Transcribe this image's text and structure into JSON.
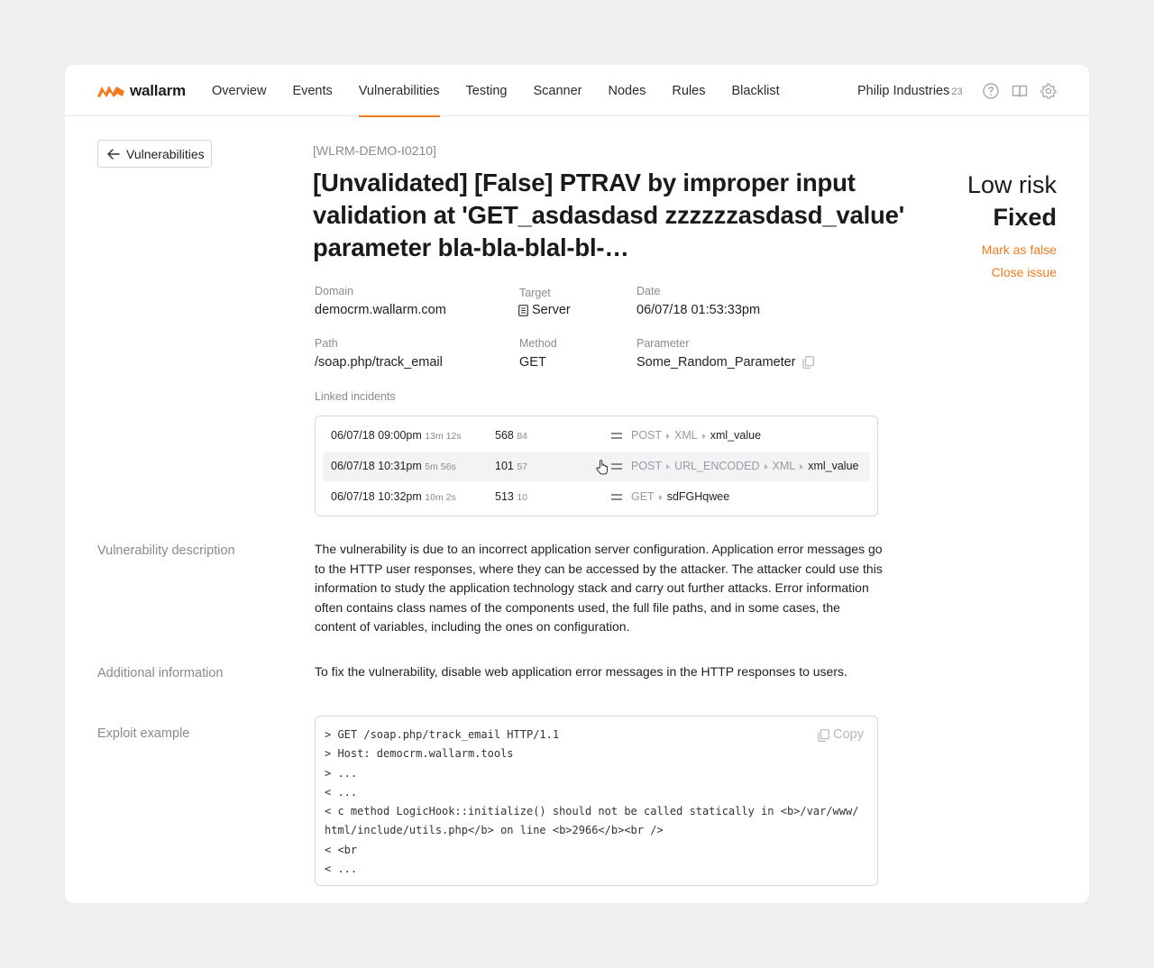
{
  "brand": {
    "name": "wallarm",
    "accent": "#f07b20"
  },
  "nav": {
    "items": [
      "Overview",
      "Events",
      "Vulnerabilities",
      "Testing",
      "Scanner",
      "Nodes",
      "Rules",
      "Blacklist"
    ],
    "active": "Vulnerabilities"
  },
  "account": {
    "name": "Philip Industries",
    "count": "23"
  },
  "header_icons": [
    "help-icon",
    "book-icon",
    "gear-icon"
  ],
  "back_button": "Vulnerabilities",
  "issue": {
    "id": "[WLRM-DEMO-I0210]",
    "title": "[Unvalidated] [False] PTRAV by improper input validation at 'GET_asdasdasd zzzzzzasdasd_value' parameter bla-bla-blal-bl-…",
    "risk": "Low risk",
    "status": "Fixed",
    "actions": {
      "mark_false": "Mark as false",
      "close": "Close issue"
    }
  },
  "fields": {
    "domain": {
      "label": "Domain",
      "value": "democrm.wallarm.com"
    },
    "target": {
      "label": "Target",
      "value": "Server"
    },
    "date": {
      "label": "Date",
      "value": "06/07/18 01:53:33pm"
    },
    "path": {
      "label": "Path",
      "value": "/soap.php/track_email"
    },
    "method": {
      "label": "Method",
      "value": "GET"
    },
    "parameter": {
      "label": "Parameter",
      "value": "Some_Random_Parameter"
    }
  },
  "linked_incidents": {
    "label": "Linked incidents",
    "rows": [
      {
        "date": "06/07/18 09:00pm",
        "duration": "13m 12s",
        "count": "568",
        "sub": "84",
        "chain": [
          "POST",
          "XML"
        ],
        "param": "xml_value"
      },
      {
        "date": "06/07/18 10:31pm",
        "duration": "5m 56s",
        "count": "101",
        "sub": "57",
        "chain": [
          "POST",
          "URL_ENCODED",
          "XML"
        ],
        "param": "xml_value"
      },
      {
        "date": "06/07/18 10:32pm",
        "duration": "10m 2s",
        "count": "513",
        "sub": "10",
        "chain": [
          "GET"
        ],
        "param": "sdFGHqwee"
      }
    ]
  },
  "description": {
    "label": "Vulnerability description",
    "text": "The vulnerability is due to an incorrect application server configuration. Application error messages go to the HTTP user responses, where they can be accessed by the attacker. The attacker could use this information to study the application technology stack and carry out further attacks. Error information often contains class names of the components used, the full file paths, and in some cases, the content of variables, including the ones on configuration."
  },
  "additional": {
    "label": "Additional information",
    "text": "To fix the vulnerability, disable web application error messages in the HTTP responses to users."
  },
  "exploit": {
    "label": "Exploit example",
    "copy_label": "Copy",
    "lines": [
      "> GET /soap.php/track_email HTTP/1.1",
      "> Host: democrm.wallarm.tools",
      "> ...",
      "< ...",
      "< c method LogicHook::initialize() should not be called statically in <b>/var/www/",
      "html/include/utils.php</b> on line <b>2966</b><br />",
      "< <br",
      "< ..."
    ]
  }
}
